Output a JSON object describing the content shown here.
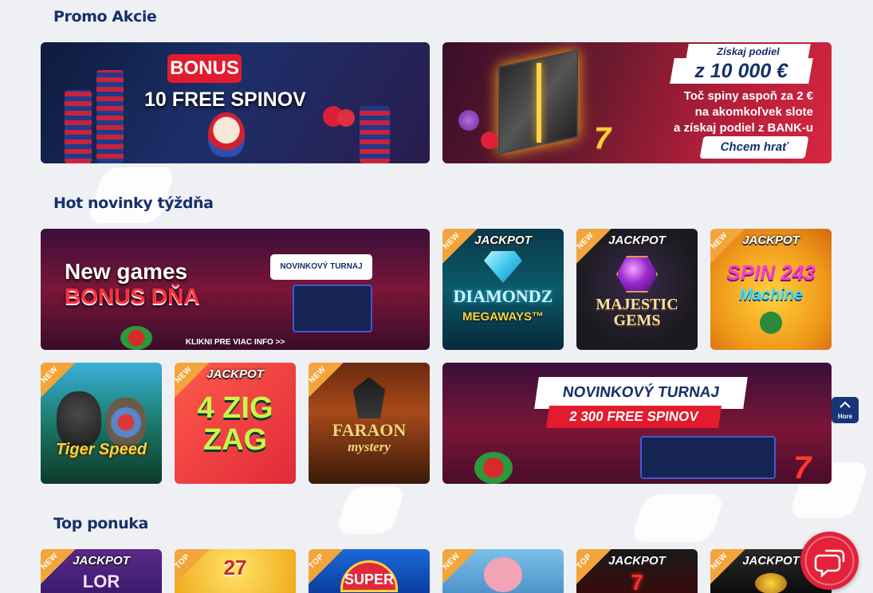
{
  "promo": {
    "title": "Promo Akcie",
    "banner1": {
      "label": "BONUS",
      "line": "10 FREE SPINOV"
    },
    "banner2": {
      "line1": "Získaj podiel",
      "line2": "z 10 000 €",
      "line3": "Toč spiny aspoň za 2 €",
      "line4": "na akomkoľvek slote",
      "line5": "a získaj podiel z BANK-u",
      "button": "Chcem hrať"
    }
  },
  "hot": {
    "title": "Hot novinky týždňa",
    "banner": {
      "line1": "New games",
      "line2": "BONUS DŇA",
      "card": "NOVINKOVÝ TURNAJ",
      "footer": "KLIKNI PRE VIAC INFO >>"
    },
    "tournament": {
      "line1": "NOVINKOVÝ TURNAJ",
      "line2": "2 300 FREE SPINOV"
    },
    "games": [
      {
        "badge": "NEW",
        "jackpot": "JACKPOT",
        "title": "DIAMONDZ",
        "subtitle": "MEGAWAYS™"
      },
      {
        "badge": "NEW",
        "jackpot": "JACKPOT",
        "title": "MAJESTIC",
        "subtitle": "GEMS"
      },
      {
        "badge": "NEW",
        "jackpot": "JACKPOT",
        "title": "SPIN 243",
        "subtitle": "Machine"
      },
      {
        "badge": "NEW",
        "jackpot": "",
        "title": "Tiger Speed",
        "subtitle": ""
      },
      {
        "badge": "NEW",
        "jackpot": "JACKPOT",
        "title": "4 ZIG",
        "subtitle": "ZAG"
      },
      {
        "badge": "NEW",
        "jackpot": "",
        "title": "FARAON",
        "subtitle": "mystery"
      }
    ]
  },
  "top": {
    "title": "Top ponuka",
    "games": [
      {
        "badge": "NEW",
        "jackpot": "JACKPOT",
        "title": "LOR"
      },
      {
        "badge": "TOP",
        "jackpot": "",
        "title": "27"
      },
      {
        "badge": "TOP",
        "jackpot": "",
        "title": "SUPER"
      },
      {
        "badge": "NEW",
        "jackpot": "",
        "title": ""
      },
      {
        "badge": "TOP",
        "jackpot": "JACKPOT",
        "title": "7"
      },
      {
        "badge": "NEW",
        "jackpot": "JACKPOT",
        "title": ""
      }
    ]
  },
  "ui": {
    "scroll_top_label": "Hore"
  }
}
